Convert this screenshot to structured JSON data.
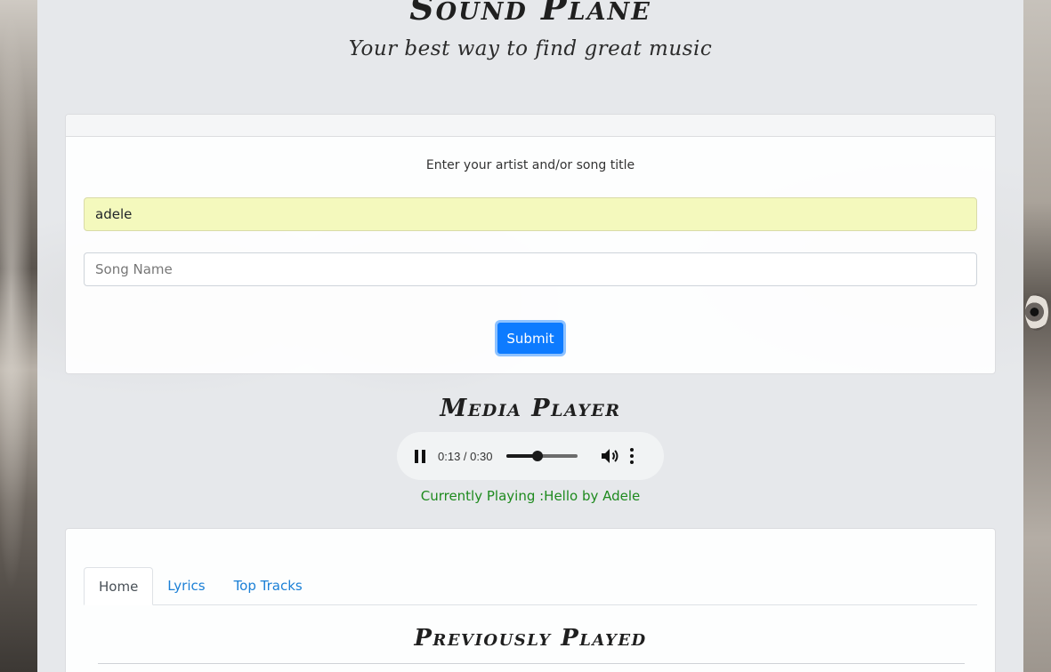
{
  "header": {
    "title": "Sound Plane",
    "subtitle": "Your best way to find great music"
  },
  "search": {
    "prompt": "Enter your artist and/or song title",
    "artist_value": "adele",
    "song_placeholder": "Song Name",
    "song_value": "",
    "submit_label": "Submit"
  },
  "media": {
    "title": "Media Player",
    "time_display": "0:13 / 0:30",
    "progress_fraction": 0.433,
    "now_playing": "Currently Playing :Hello by Adele"
  },
  "tabs": {
    "items": [
      {
        "label": "Home",
        "active": true
      },
      {
        "label": "Lyrics",
        "active": false
      },
      {
        "label": "Top Tracks",
        "active": false
      }
    ]
  },
  "previously_played": {
    "title": "Previously Played"
  },
  "colors": {
    "submit_button": "#0d7bff",
    "now_playing_text": "#1e8a1e",
    "tab_link": "#1a7fd6",
    "autofill_field": "#f4f9bd"
  },
  "icons": {
    "play_state": "pause-icon",
    "volume": "volume-icon",
    "menu": "more-vertical-icon"
  }
}
